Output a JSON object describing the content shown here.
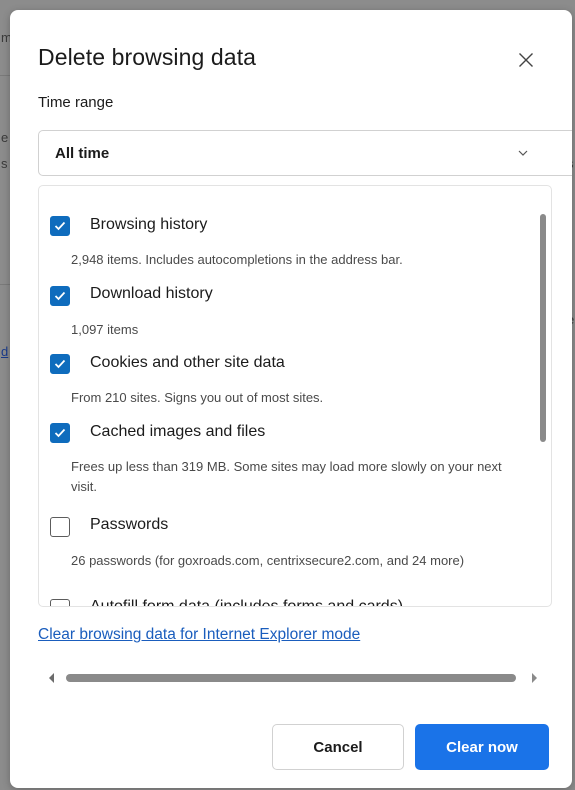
{
  "background": {
    "fragments": [
      "m",
      "e",
      "s",
      "d",
      "s",
      "e"
    ]
  },
  "dialog": {
    "title": "Delete browsing data",
    "close_icon": "close-icon",
    "time_range": {
      "label": "Time range",
      "value": "All time",
      "icon": "chevron-down-icon"
    },
    "items": [
      {
        "label": "Browsing history",
        "checked": true,
        "description": "2,948 items. Includes autocompletions in the address bar."
      },
      {
        "label": "Download history",
        "checked": true,
        "description": "1,097 items"
      },
      {
        "label": "Cookies and other site data",
        "checked": true,
        "description": "From 210 sites. Signs you out of most sites."
      },
      {
        "label": "Cached images and files",
        "checked": true,
        "description": "Frees up less than 319 MB. Some sites may load more slowly on your next visit."
      },
      {
        "label": "Passwords",
        "checked": false,
        "description": "26 passwords (for goxroads.com, centrixsecure2.com, and 24 more)"
      },
      {
        "label": "Autofill form data (includes forms and cards)",
        "checked": false,
        "description": ""
      }
    ],
    "ie_link": "Clear browsing data for Internet Explorer mode",
    "buttons": {
      "cancel": "Cancel",
      "clear": "Clear now"
    }
  },
  "colors": {
    "accent": "#1a73e8",
    "checkbox": "#0f6cbd",
    "link": "#1a5dbd"
  }
}
